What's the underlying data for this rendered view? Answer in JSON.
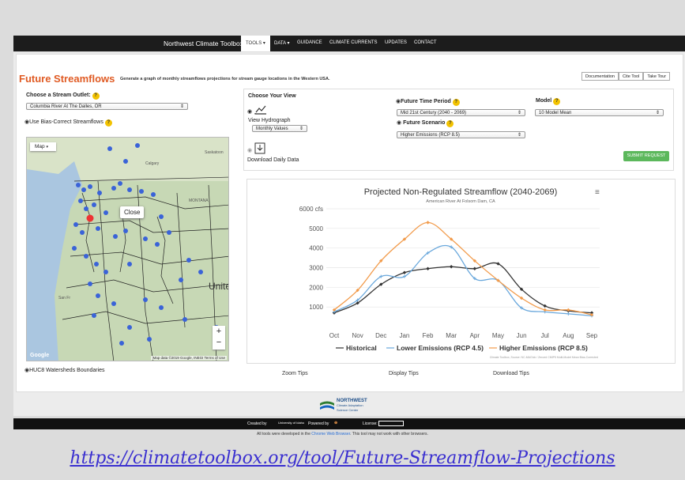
{
  "nav": {
    "brand": "Northwest Climate Toolbox",
    "items": [
      "TOOLS ▾",
      "DATA ▾",
      "GUIDANCE",
      "CLIMATE CURRENTS",
      "UPDATES",
      "CONTACT"
    ]
  },
  "page": {
    "title": "Future Streamflows",
    "subtitle": "Generate a graph of monthly streamflows projections for stream gauge locations in the Western USA.",
    "buttons": [
      "Documentation",
      "Cite Tool",
      "Take Tour"
    ]
  },
  "left": {
    "outlet_label": "Choose a Stream Outlet:",
    "outlet_value": "Columbia River At The Dalles, OR",
    "bias_label": "Use Bias-Correct Streamflows",
    "map_type": "Map",
    "popup": "Close",
    "google": "Google",
    "map_attr": "Map data ©2019 Google, INEGI   Terms of Use",
    "huc_label": "HUC8 Watersheds Boundaries",
    "places": [
      "Calgary",
      "Saskatoon",
      "MONTANA",
      "Unite",
      "San Fr"
    ]
  },
  "view": {
    "label": "Choose Your View",
    "hydro": "View Hydrograph",
    "hydro_select": "Monthly Values",
    "download": "Download Daily Data"
  },
  "options": {
    "period_label": "Future Time Period",
    "period_value": "Mid 21st Century (2040 - 2069)",
    "model_label": "Model",
    "model_value": "10 Model Mean",
    "scenario_label": "Future Scenario",
    "scenario_value": "Higher Emissions (RCP 8.5)",
    "submit": "SUBMIT REQUEST"
  },
  "tips": [
    "Zoom Tips",
    "Display Tips",
    "Download Tips"
  ],
  "footer": {
    "created": "Created by",
    "uni": "University of Idaho",
    "powered": "Powered by",
    "license": "License:",
    "logo1": "NORTHWEST",
    "logo2": "Climate Adaptation",
    "logo3": "Science Center",
    "note_before": "All tools were developed in the ",
    "note_link": "Chrome Web Browser",
    "note_after": ". This tool may not work with other browsers."
  },
  "url": "https://climatetoolbox.org/tool/Future-Streamflow-Projections",
  "chart_data": {
    "type": "line",
    "title": "Projected Non-Regulated Streamflow (2040-2069)",
    "subtitle": "American River At Folsom Dam, CA",
    "categories": [
      "Oct",
      "Nov",
      "Dec",
      "Jan",
      "Feb",
      "Mar",
      "Apr",
      "May",
      "Jun",
      "Jul",
      "Aug",
      "Sep"
    ],
    "yticks": [
      1000,
      2000,
      3000,
      4000,
      5000,
      6000
    ],
    "ytick_labels": [
      "1000",
      "2000",
      "3000",
      "4000",
      "5000",
      "6000 cfs"
    ],
    "ylim": [
      0,
      6000
    ],
    "credit": "Climate Toolbox, Source: NC-MAGIck / Zeroed CMIP5 Multi-Model Mean Bias-Corrected",
    "series": [
      {
        "name": "Historical",
        "color": "#333333",
        "marker": "◆",
        "values": [
          700,
          1200,
          2150,
          2750,
          2950,
          3050,
          2950,
          3200,
          1900,
          1050,
          800,
          700
        ]
      },
      {
        "name": "Lower Emissions (RCP 4.5)",
        "color": "#6aa8dc",
        "marker": "+",
        "values": [
          750,
          1350,
          2550,
          2550,
          3750,
          4050,
          2450,
          2350,
          950,
          750,
          650,
          550
        ]
      },
      {
        "name": "Higher Emissions (RCP 8.5)",
        "color": "#f29b4b",
        "marker": "◆",
        "values": [
          850,
          1850,
          3350,
          4450,
          5300,
          4450,
          3350,
          2350,
          1450,
          850,
          850,
          600
        ]
      }
    ]
  }
}
